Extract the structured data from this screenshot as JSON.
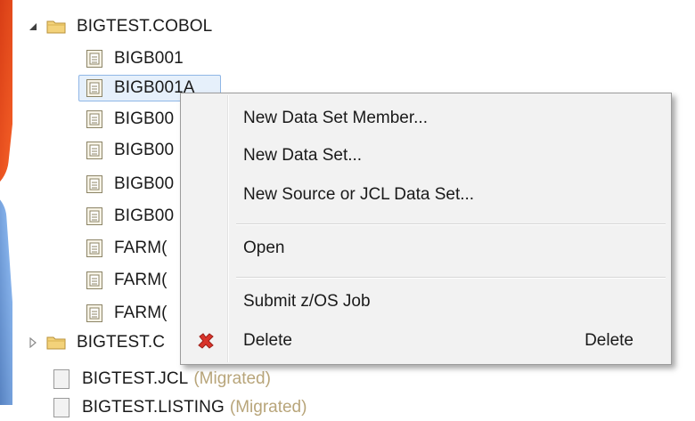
{
  "tree": {
    "root": {
      "label": "BIGTEST.COBOL",
      "expanded": true,
      "members": [
        "BIGB001",
        "BIGB001A",
        "BIGB00",
        "BIGB00",
        "BIGB00",
        "BIGB00",
        "FARM(",
        "FARM(",
        "FARM("
      ]
    },
    "collapsed_folder": {
      "label": "BIGTEST.C"
    },
    "dataset_jcl": {
      "label": "BIGTEST.JCL",
      "status": "(Migrated)"
    },
    "dataset_listing": {
      "label": "BIGTEST.LISTING",
      "status": "(Migrated)"
    },
    "selected_member": "BIGB001A"
  },
  "context_menu": {
    "items": [
      {
        "label": "New Data Set Member...",
        "icon": "",
        "shortcut": ""
      },
      {
        "label": "New Data Set...",
        "icon": "",
        "shortcut": ""
      },
      {
        "label": "New Source or JCL Data Set...",
        "icon": "",
        "shortcut": ""
      },
      {
        "label": "Open",
        "icon": "",
        "shortcut": ""
      },
      {
        "label": "Submit z/OS Job",
        "icon": "",
        "shortcut": ""
      },
      {
        "label": "Delete",
        "icon": "red-x-delete-icon",
        "shortcut": "Delete"
      }
    ]
  },
  "colors": {
    "selection_bg": "#e6f0fb",
    "selection_border": "#8fb6e6",
    "menu_bg": "#f2f2f2",
    "migrated_text": "#b8a57a",
    "delete_icon": "#d9342b",
    "folder": "#e8c15a"
  }
}
